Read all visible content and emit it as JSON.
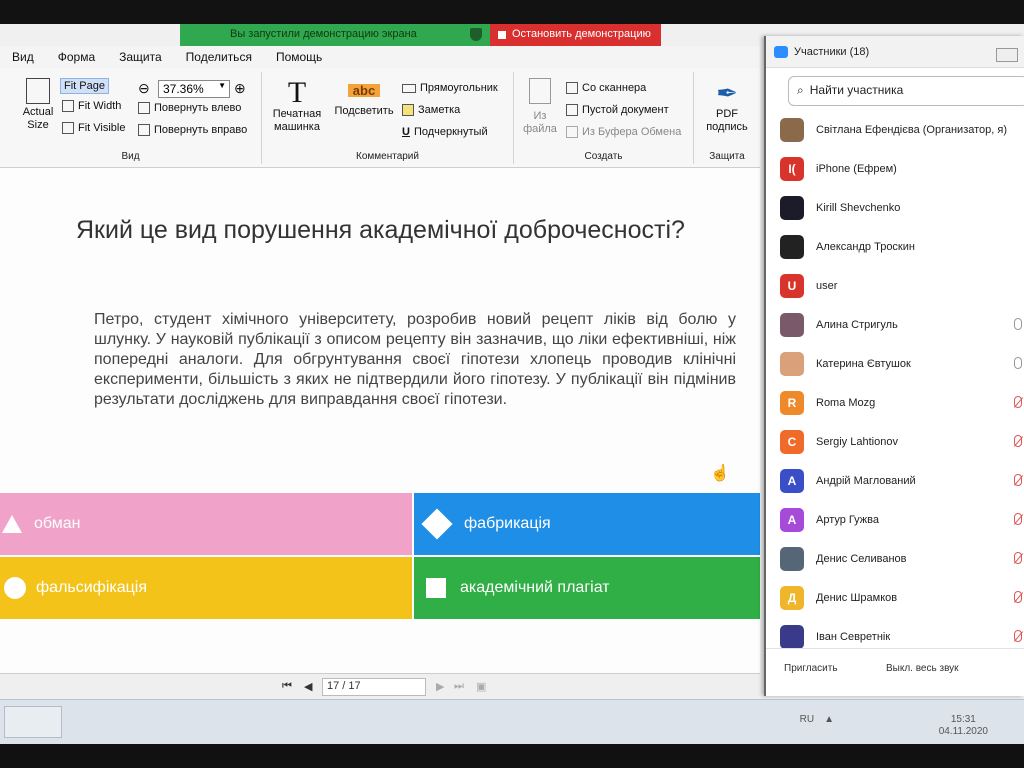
{
  "share": {
    "message": "Вы запустили демонстрацию экрана",
    "stop_label": "Остановить демонстрацию"
  },
  "menu": [
    "Вид",
    "Форма",
    "Защита",
    "Поделиться",
    "Помощь"
  ],
  "ribbon": {
    "actual_size": "Actual Size",
    "fit_page": "Fit Page",
    "fit_width": "Fit Width",
    "fit_visible": "Fit Visible",
    "zoom": "37.36%",
    "rotate_left": "Повернуть влево",
    "rotate_right": "Повернуть вправо",
    "group_view": "Вид",
    "typewriter": "Печатная машинка",
    "highlight": "Подсветить",
    "highlight_icon": "abc",
    "rectangle": "Прямоугольник",
    "note": "Заметка",
    "underline": "Подчеркнутый",
    "group_comment": "Комментарий",
    "from_file": "Из файла",
    "from_scanner": "Со сканнера",
    "blank_doc": "Пустой документ",
    "from_clipboard": "Из Буфера Обмена",
    "group_create": "Создать",
    "pdf_sign": "PDF подпись",
    "group_protect": "Защита"
  },
  "doc": {
    "title": "Який це вид порушення академічної доброчесності?",
    "body": "Петро, студент хімічного університету, розробив новий рецепт ліків від болю у шлунку. У науковій публікації з описом рецепту він зазначив, що ліки ефективніші, ніж попередні аналоги. Для обгрунтування своєї гіпотези хлопець проводив клінічні експерименти, більшість з яких не підтвердили його гіпотезу. У публікації він підмінив результати досліджень для виправдання своєї гіпотези.",
    "answers": {
      "a1": "обман",
      "a2": "фабрикація",
      "a3": "фальсифікація",
      "a4": "академічний плагіат"
    },
    "colors": {
      "pink": "#f0a2c9",
      "blue": "#1e8ee6",
      "yellow": "#f3c31a",
      "green": "#2faf45"
    }
  },
  "nav": {
    "page": "17 / 17"
  },
  "taskbar": {
    "lang": "RU",
    "time": "15:31",
    "date": "04.11.2020"
  },
  "participants": {
    "title": "Участники (18)",
    "search_placeholder": "Найти участника",
    "list": [
      {
        "name": "Світлана Ефендієва (Организатор, я)",
        "initial": "",
        "color": "#8a6a4a"
      },
      {
        "name": "iPhone (Ефрем)",
        "initial": "I(",
        "color": "#d9342b"
      },
      {
        "name": "Kirill Shevchenko",
        "initial": "",
        "color": "#1b1b2a"
      },
      {
        "name": "Александр Троскин",
        "initial": "",
        "color": "#222222"
      },
      {
        "name": "user",
        "initial": "U",
        "color": "#d9342b"
      },
      {
        "name": "Алина Стригуль",
        "initial": "",
        "color": "#7a5a6a"
      },
      {
        "name": "Катерина Євтушок",
        "initial": "",
        "color": "#d9a07a"
      },
      {
        "name": "Roma Mozg",
        "initial": "R",
        "color": "#f0892a"
      },
      {
        "name": "Sergiy Lahtionov",
        "initial": "C",
        "color": "#f06a2a"
      },
      {
        "name": "Андрій Маглований",
        "initial": "A",
        "color": "#3a4ec8"
      },
      {
        "name": "Артур Гужва",
        "initial": "A",
        "color": "#a64ad8"
      },
      {
        "name": "Денис Селиванов",
        "initial": "",
        "color": "#556677"
      },
      {
        "name": "Денис Шрамков",
        "initial": "Д",
        "color": "#f0b62a"
      },
      {
        "name": "Іван Севретнік",
        "initial": "",
        "color": "#3a3a8a"
      }
    ],
    "invite": "Пригласить",
    "mute_all": "Выкл. весь звук"
  }
}
